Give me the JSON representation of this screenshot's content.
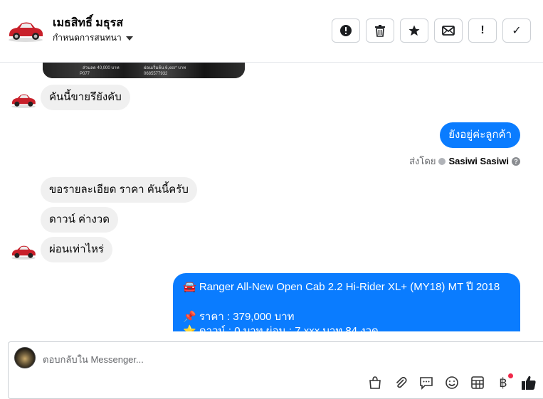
{
  "header": {
    "contact_name": "เมธสิทธิ์ มธุรส",
    "assign_label": "กำหนดการสนทนา",
    "buttons": {
      "spam": "!",
      "mark_done": "✓"
    }
  },
  "messages": [
    {
      "id": "m1",
      "direction": "incoming",
      "text": "คันนี้ขายรึยังคับ"
    },
    {
      "id": "m2",
      "direction": "outgoing",
      "text": "ยังอยู่ค่ะลูกค้า"
    },
    {
      "id": "m3",
      "direction": "incoming",
      "text": "ขอรายละเอียด ราคา คันนี้ครับ"
    },
    {
      "id": "m4",
      "direction": "incoming",
      "text": "ดาวน์ ค่างวด"
    },
    {
      "id": "m5",
      "direction": "incoming",
      "text": "ผ่อนเท่าไหร่"
    }
  ],
  "sent_by": {
    "prefix": "ส่งโดย",
    "agent": "Sasiwi Sasiwi"
  },
  "image_strip": {
    "texts": [
      "ส่วนลด 40,000 บาท",
      "ผ่อนเริ่มต้น 6,xxx* บาท",
      "P077",
      "0685577932"
    ]
  },
  "listing": {
    "title_line": "🚘 Ranger All-New Open Cab 2.2 Hi-Rider XL+ (MY18) MT ปี 2018",
    "price_line": "📌 ราคา : 379,000 บาท",
    "down_line": "⭐ ดาวน์ : 0 บาท ผ่อน : 7,xxx บาท 84 งวด"
  },
  "composer": {
    "placeholder": "ตอบกลับใน Messenger..."
  },
  "icons": {
    "currency_symbol": "฿"
  },
  "colors": {
    "outgoing_bubble": "#0a7cff",
    "incoming_bubble": "#f0f0f0",
    "notify_dot": "#f02849"
  }
}
